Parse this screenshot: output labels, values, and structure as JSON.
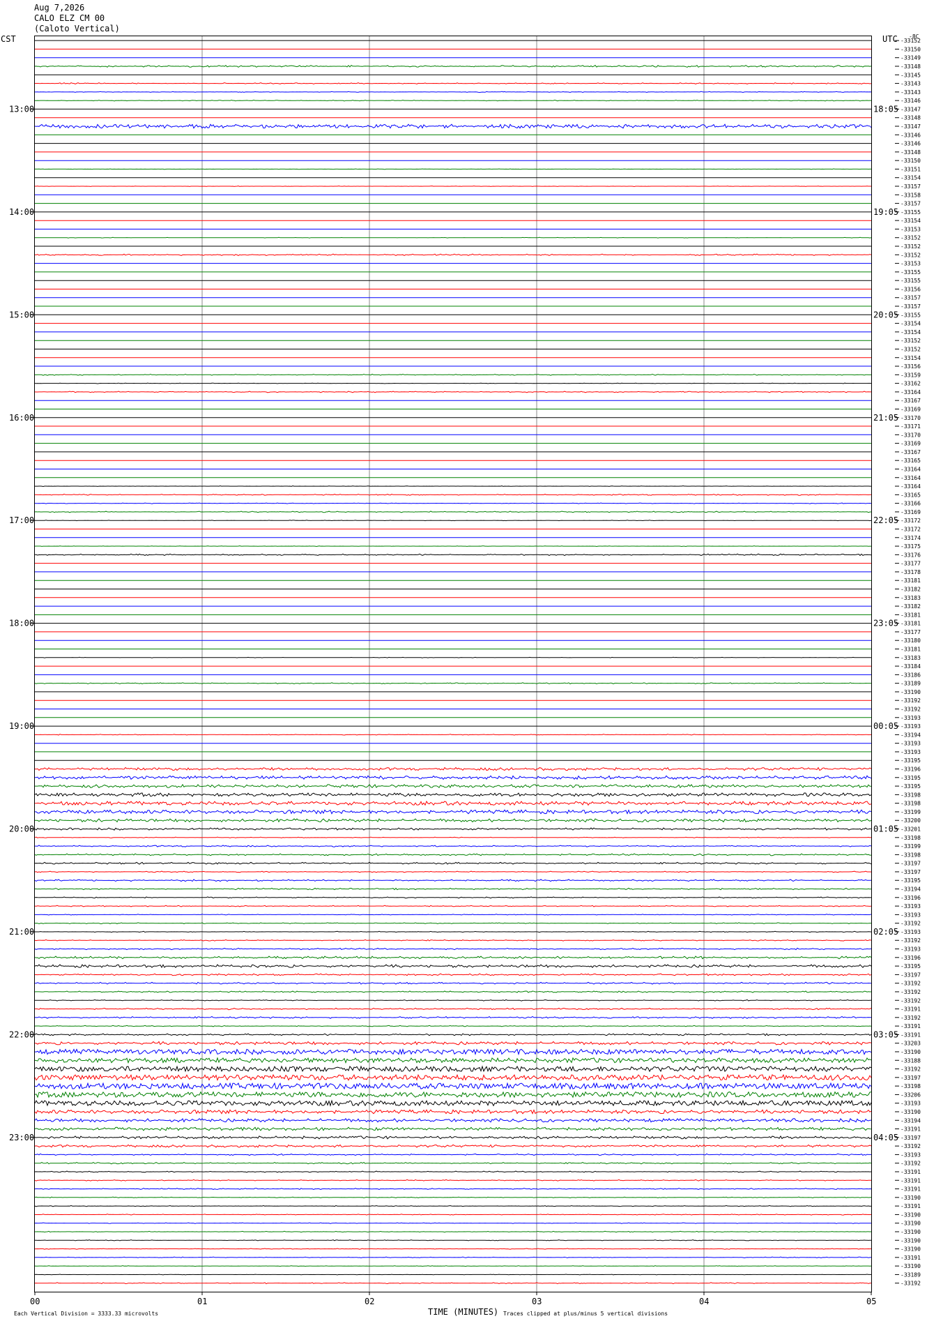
{
  "header": {
    "date": "Aug 7,2026",
    "station": "CALO ELZ CM 00",
    "location": "(Caloto Vertical)"
  },
  "left_tz": "CST",
  "right_tz": "UTC",
  "footer": {
    "left_note": "Each Vertical Division = 3333.33 microvolts",
    "xlabel": "TIME (MINUTES)",
    "clip_note": "Traces clipped at plus/minus 5 vertical divisions"
  },
  "chart_data": {
    "type": "line",
    "title": "CALO ELZ CM 00 (Caloto Vertical)",
    "xlabel": "TIME (MINUTES)",
    "xlim": [
      0,
      5
    ],
    "x_ticks": [
      "00",
      "01",
      "02",
      "03",
      "04",
      "05"
    ],
    "trace_colors": [
      "#000000",
      "#ff0000",
      "#0000ff",
      "#008000"
    ],
    "rows_per_hour": 12,
    "first_row_minute": 20,
    "hour_ticks": [
      {
        "row": 8,
        "cst": "13:00",
        "utc": "18:05"
      },
      {
        "row": 20,
        "cst": "14:00",
        "utc": "19:05"
      },
      {
        "row": 32,
        "cst": "15:00",
        "utc": "20:05"
      },
      {
        "row": 44,
        "cst": "16:00",
        "utc": "21:05"
      },
      {
        "row": 56,
        "cst": "17:00",
        "utc": "22:05"
      },
      {
        "row": 68,
        "cst": "18:00",
        "utc": "23:05"
      },
      {
        "row": 80,
        "cst": "19:00",
        "utc": "00:05"
      },
      {
        "row": 92,
        "cst": "20:00",
        "utc": "01:05"
      },
      {
        "row": 104,
        "cst": "21:00",
        "utc": "02:05"
      },
      {
        "row": 116,
        "cst": "22:00",
        "utc": "03:05"
      },
      {
        "row": 128,
        "cst": "23:00",
        "utc": "04:05"
      }
    ],
    "row_offsets": [
      -33152,
      -33150,
      -33149,
      -33148,
      -33145,
      -33143,
      -33143,
      -33146,
      -33147,
      -33148,
      -33147,
      -33146,
      -33146,
      -33148,
      -33150,
      -33151,
      -33154,
      -33157,
      -33158,
      -33157,
      -33155,
      -33154,
      -33153,
      -33152,
      -33152,
      -33152,
      -33153,
      -33155,
      -33155,
      -33156,
      -33157,
      -33157,
      -33155,
      -33154,
      -33154,
      -33152,
      -33152,
      -33154,
      -33156,
      -33159,
      -33162,
      -33164,
      -33167,
      -33169,
      -33170,
      -33171,
      -33170,
      -33169,
      -33167,
      -33165,
      -33164,
      -33164,
      -33164,
      -33165,
      -33166,
      -33169,
      -33172,
      -33172,
      -33174,
      -33175,
      -33176,
      -33177,
      -33178,
      -33181,
      -33182,
      -33183,
      -33182,
      -33181,
      -33181,
      -33177,
      -33180,
      -33181,
      -33183,
      -33184,
      -33186,
      -33189,
      -33190,
      -33192,
      -33192,
      -33193,
      -33193,
      -33194,
      -33193,
      -33193,
      -33195,
      -33196,
      -33195,
      -33195,
      -33198,
      -33198,
      -33199,
      -33200,
      -33201,
      -33198,
      -33199,
      -33198,
      -33197,
      -33197,
      -33195,
      -33194,
      -33196,
      -33193,
      -33193,
      -33192,
      -33193,
      -33192,
      -33193,
      -33196,
      -33195,
      -33197,
      -33192,
      -33192,
      -33192,
      -33191,
      -33192,
      -33191,
      -33191,
      -33203,
      -33190,
      -33188,
      -33192,
      -33197,
      -33198,
      -33206,
      -33193,
      -33190,
      -33194,
      -33191,
      -33197,
      -33192,
      -33193,
      -33192,
      -33191,
      -33191,
      -33191,
      -33190,
      -33191,
      -33190,
      -33190,
      -33190,
      -33190,
      -33190,
      -33191,
      -33190,
      -33189,
      -33192
    ],
    "top_label": "-8C",
    "row_activity": [
      0,
      0,
      0,
      0.3,
      0,
      0.2,
      0.15,
      0.15,
      0,
      0,
      0.6,
      0,
      0,
      0,
      0,
      0.1,
      0,
      0.1,
      0,
      0,
      0,
      0,
      0,
      0.1,
      0,
      0.25,
      0,
      0,
      0,
      0,
      0,
      0,
      0,
      0,
      0,
      0,
      0,
      0,
      0,
      0.2,
      0.1,
      0.2,
      0,
      0,
      0,
      0,
      0,
      0,
      0,
      0,
      0,
      0,
      0.1,
      0.2,
      0.15,
      0.2,
      0.1,
      0,
      0,
      0.1,
      0.25,
      0,
      0,
      0,
      0,
      0,
      0,
      0,
      0,
      0,
      0,
      0,
      0.1,
      0,
      0,
      0.2,
      0,
      0,
      0,
      0,
      0,
      0.15,
      0,
      0,
      0,
      0.45,
      0.55,
      0.5,
      0.55,
      0.6,
      0.6,
      0.5,
      0.35,
      0.15,
      0.25,
      0.3,
      0.3,
      0.2,
      0.3,
      0.25,
      0.2,
      0.2,
      0.15,
      0.2,
      0.15,
      0.2,
      0.25,
      0.4,
      0.45,
      0.3,
      0.3,
      0.25,
      0.2,
      0.25,
      0.3,
      0.2,
      0.3,
      0.5,
      0.8,
      0.75,
      0.8,
      0.85,
      0.9,
      0.85,
      0.8,
      0.6,
      0.55,
      0.5,
      0.45,
      0.4,
      0.25,
      0.25,
      0.2,
      0.2,
      0.2,
      0.15,
      0.15,
      0.15,
      0.15,
      0.15,
      0.15,
      0.15,
      0.15,
      0.1,
      0.1,
      0.2
    ]
  }
}
